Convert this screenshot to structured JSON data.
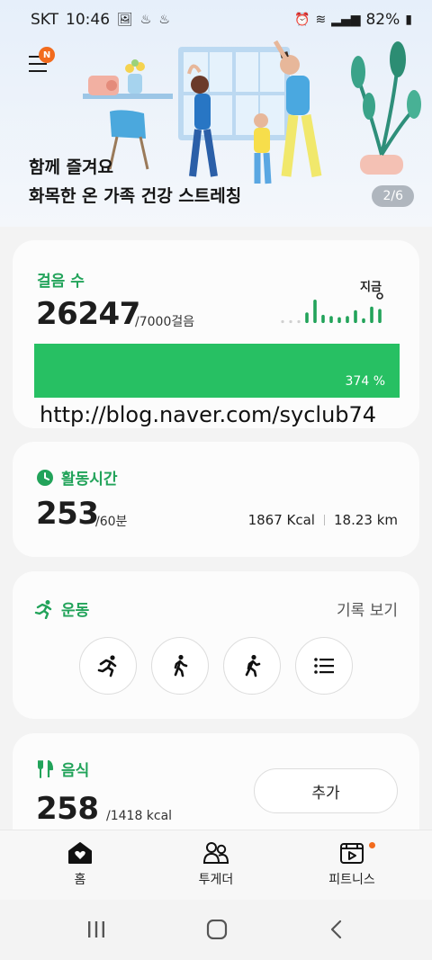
{
  "status_bar": {
    "carrier": "SKT",
    "time": "10:46",
    "battery": "82%"
  },
  "banner": {
    "badge": "N",
    "line1": "함께 즐겨요",
    "line2": "화목한 온 가족 건강 스트레칭",
    "page_indicator": "2/6"
  },
  "steps_card": {
    "title": "걸음 수",
    "count": "26247",
    "goal": "/7000걸음",
    "now_label": "지금",
    "progress_percent": 374,
    "progress_label": "374 %",
    "watermark": "http://blog.naver.com/syclub74",
    "hourly_levels": [
      0,
      0,
      0,
      0.45,
      1,
      0.35,
      0.3,
      0.25,
      0.3,
      0.55,
      0.2,
      0.7,
      0.6
    ]
  },
  "activity_card": {
    "title": "활동시간",
    "minutes": "253",
    "goal": "/60분",
    "kcal": "1867 Kcal",
    "distance": "18.23 km"
  },
  "exercise_card": {
    "title": "운동",
    "records_label": "기록 보기",
    "buttons": [
      "running-icon",
      "walking-icon",
      "hiking-icon",
      "list-icon"
    ]
  },
  "food_card": {
    "title": "음식",
    "kcal": "258",
    "goal": "/1418 kcal",
    "add_label": "추가"
  },
  "bottom_nav": {
    "items": [
      {
        "label": "홈",
        "icon": "home-heart-icon"
      },
      {
        "label": "투게더",
        "icon": "people-icon"
      },
      {
        "label": "피트니스",
        "icon": "fitness-video-icon"
      }
    ]
  },
  "colors": {
    "accent_green": "#22a35a",
    "progress_green": "#27c063",
    "badge_orange": "#f26b1d"
  }
}
